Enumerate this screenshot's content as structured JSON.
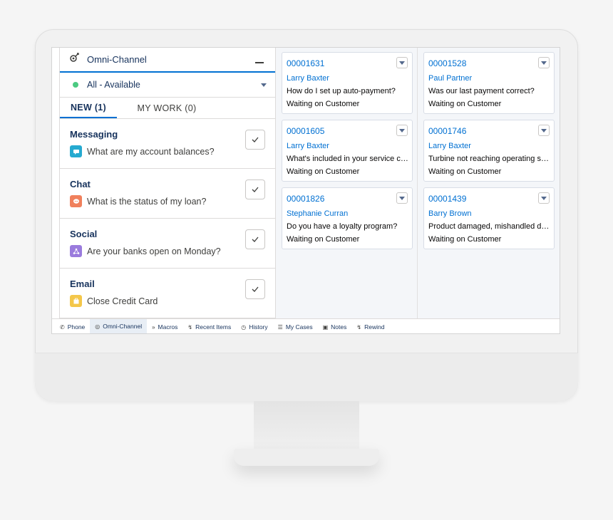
{
  "omni": {
    "title": "Omni-Channel",
    "status": "All - Available",
    "tabs": {
      "new": "NEW (1)",
      "mywork": "MY WORK (0)"
    },
    "items": [
      {
        "type": "Messaging",
        "message": "What are my account balances?",
        "icon": "messaging-icon",
        "color": "#26aad0"
      },
      {
        "type": "Chat",
        "message": "What is the status of my loan?",
        "icon": "chat-icon",
        "color": "#f0805c"
      },
      {
        "type": "Social",
        "message": "Are your banks open on Monday?",
        "icon": "social-icon",
        "color": "#9a7bdd"
      },
      {
        "type": "Email",
        "message": "Close Credit Card",
        "icon": "email-icon",
        "color": "#f4c74a"
      }
    ]
  },
  "cases": [
    {
      "number": "00001631",
      "contact": "Larry Baxter",
      "subject": "How do I set up auto-payment?",
      "status": "Waiting on Customer"
    },
    {
      "number": "00001528",
      "contact": "Paul Partner",
      "subject": "Was our last payment correct?",
      "status": "Waiting on Customer"
    },
    {
      "number": "00001605",
      "contact": "Larry Baxter",
      "subject": "What's included in your service con...",
      "status": "Waiting on Customer"
    },
    {
      "number": "00001746",
      "contact": "Larry Baxter",
      "subject": "Turbine not reaching operating spe...",
      "status": "Waiting on Customer"
    },
    {
      "number": "00001826",
      "contact": "Stephanie Curran",
      "subject": "Do you have a loyalty program?",
      "status": "Waiting on Customer"
    },
    {
      "number": "00001439",
      "contact": "Barry Brown",
      "subject": "Product damaged, mishandled dur...",
      "status": "Waiting on Customer"
    }
  ],
  "utility_bar": [
    {
      "label": "Phone",
      "icon": "phone-icon"
    },
    {
      "label": "Omni-Channel",
      "icon": "omni-channel-icon",
      "active": true
    },
    {
      "label": "Macros",
      "icon": "macros-icon"
    },
    {
      "label": "Recent Items",
      "icon": "lightning-icon"
    },
    {
      "label": "History",
      "icon": "clock-icon"
    },
    {
      "label": "My Cases",
      "icon": "list-icon"
    },
    {
      "label": "Notes",
      "icon": "notes-icon"
    },
    {
      "label": "Rewind",
      "icon": "lightning-icon"
    }
  ],
  "colors": {
    "brand": "#0070d2",
    "available": "#4bca81"
  }
}
